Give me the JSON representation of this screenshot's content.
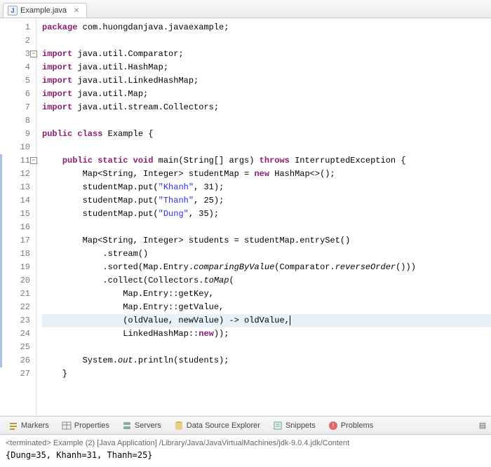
{
  "tab": {
    "filename": "Example.java",
    "icon_letter": "J"
  },
  "code": {
    "lines": [
      {
        "n": 1,
        "tokens": [
          [
            "kw",
            "package"
          ],
          [
            "",
            " com.huongdanjava.javaexample;"
          ]
        ]
      },
      {
        "n": 2,
        "tokens": []
      },
      {
        "n": 3,
        "fold": true,
        "tokens": [
          [
            "kw",
            "import"
          ],
          [
            "",
            " java.util.Comparator;"
          ]
        ]
      },
      {
        "n": 4,
        "tokens": [
          [
            "kw",
            "import"
          ],
          [
            "",
            " java.util.HashMap;"
          ]
        ]
      },
      {
        "n": 5,
        "tokens": [
          [
            "kw",
            "import"
          ],
          [
            "",
            " java.util.LinkedHashMap;"
          ]
        ]
      },
      {
        "n": 6,
        "tokens": [
          [
            "kw",
            "import"
          ],
          [
            "",
            " java.util.Map;"
          ]
        ]
      },
      {
        "n": 7,
        "tokens": [
          [
            "kw",
            "import"
          ],
          [
            "",
            " java.util.stream.Collectors;"
          ]
        ]
      },
      {
        "n": 8,
        "tokens": []
      },
      {
        "n": 9,
        "tokens": [
          [
            "kw",
            "public class"
          ],
          [
            "",
            " Example {"
          ]
        ]
      },
      {
        "n": 10,
        "tokens": []
      },
      {
        "n": 11,
        "fold": true,
        "changed": true,
        "tokens": [
          [
            "",
            "    "
          ],
          [
            "kw",
            "public static void"
          ],
          [
            "",
            " main(String[] args) "
          ],
          [
            "kw",
            "throws"
          ],
          [
            "",
            " InterruptedException {"
          ]
        ]
      },
      {
        "n": 12,
        "changed": true,
        "tokens": [
          [
            "",
            "        Map<String, Integer> studentMap = "
          ],
          [
            "kw",
            "new"
          ],
          [
            "",
            " HashMap<>();"
          ]
        ]
      },
      {
        "n": 13,
        "changed": true,
        "tokens": [
          [
            "",
            "        studentMap.put("
          ],
          [
            "str",
            "\"Khanh\""
          ],
          [
            "",
            ", 31);"
          ]
        ]
      },
      {
        "n": 14,
        "changed": true,
        "tokens": [
          [
            "",
            "        studentMap.put("
          ],
          [
            "str",
            "\"Thanh\""
          ],
          [
            "",
            ", 25);"
          ]
        ]
      },
      {
        "n": 15,
        "changed": true,
        "tokens": [
          [
            "",
            "        studentMap.put("
          ],
          [
            "str",
            "\"Dung\""
          ],
          [
            "",
            ", 35);"
          ]
        ]
      },
      {
        "n": 16,
        "changed": true,
        "tokens": []
      },
      {
        "n": 17,
        "changed": true,
        "tokens": [
          [
            "",
            "        Map<String, Integer> students = studentMap.entrySet()"
          ]
        ]
      },
      {
        "n": 18,
        "changed": true,
        "tokens": [
          [
            "",
            "            .stream()"
          ]
        ]
      },
      {
        "n": 19,
        "changed": true,
        "tokens": [
          [
            "",
            "            .sorted(Map.Entry."
          ],
          [
            "method-static",
            "comparingByValue"
          ],
          [
            "",
            "(Comparator."
          ],
          [
            "sel",
            ""
          ],
          [
            "method-static",
            "reverseOrder"
          ],
          [
            "",
            "()))"
          ]
        ]
      },
      {
        "n": 20,
        "changed": true,
        "tokens": [
          [
            "",
            "            .collect(Collectors."
          ],
          [
            "method-static",
            "toMap"
          ],
          [
            "",
            "("
          ]
        ]
      },
      {
        "n": 21,
        "changed": true,
        "tokens": [
          [
            "",
            "                Map.Entry::getKey,"
          ]
        ]
      },
      {
        "n": 22,
        "changed": true,
        "tokens": [
          [
            "",
            "                Map.Entry::getValue,"
          ]
        ]
      },
      {
        "n": 23,
        "changed": true,
        "hl": true,
        "caret_after": true,
        "tokens": [
          [
            "",
            "                (oldValue, newValue) -> oldValue,"
          ]
        ]
      },
      {
        "n": 24,
        "changed": true,
        "tokens": [
          [
            "",
            "                LinkedHashMap::"
          ],
          [
            "kw",
            "new"
          ],
          [
            "",
            "));"
          ]
        ]
      },
      {
        "n": 25,
        "changed": true,
        "tokens": []
      },
      {
        "n": 26,
        "changed": true,
        "tokens": [
          [
            "",
            "        System."
          ],
          [
            "method-static",
            "out"
          ],
          [
            "",
            ".println(students);"
          ]
        ]
      },
      {
        "n": 27,
        "tokens": [
          [
            "",
            "    }"
          ]
        ]
      }
    ]
  },
  "views": {
    "items": [
      {
        "label": "Markers",
        "icon": "markers"
      },
      {
        "label": "Properties",
        "icon": "properties"
      },
      {
        "label": "Servers",
        "icon": "servers"
      },
      {
        "label": "Data Source Explorer",
        "icon": "db"
      },
      {
        "label": "Snippets",
        "icon": "snippets"
      },
      {
        "label": "Problems",
        "icon": "problems"
      }
    ]
  },
  "console": {
    "status": "<terminated> Example (2) [Java Application] /Library/Java/JavaVirtualMachines/jdk-9.0.4.jdk/Content",
    "output": "{Dung=35, Khanh=31, Thanh=25}"
  }
}
